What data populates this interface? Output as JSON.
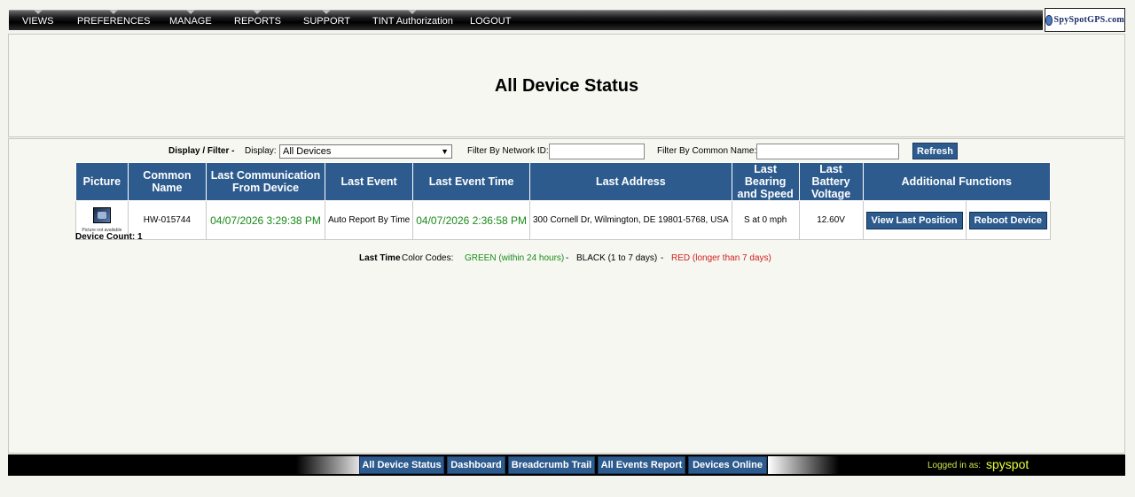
{
  "nav": {
    "items": [
      "VIEWS",
      "PREFERENCES",
      "MANAGE",
      "REPORTS",
      "SUPPORT",
      "TINT Authorization",
      "LOGOUT"
    ],
    "logo_text": "SpySpotGPS.com"
  },
  "page": {
    "title": "All Device Status"
  },
  "filter": {
    "heading": "Display / Filter -",
    "display_label": "Display:",
    "display_value": "All Devices",
    "network_label": "Filter By Network ID:",
    "network_value": "",
    "common_name_label": "Filter By Common Name:",
    "common_name_value": "",
    "refresh_label": "Refresh"
  },
  "table": {
    "headers": {
      "picture": "Picture",
      "common_name": "Common Name",
      "last_comm": "Last Communication From Device",
      "last_event": "Last Event",
      "last_event_time": "Last Event Time",
      "last_address": "Last Address",
      "bearing": "Last Bearing and Speed",
      "battery": "Last Battery Voltage",
      "functions": "Additional Functions"
    },
    "rows": [
      {
        "picture_caption": "Picture not available",
        "common_name": "HW-015744",
        "last_comm": "04/07/2026 3:29:38 PM",
        "last_event": "Auto Report By Time",
        "last_event_time": "04/07/2026 2:36:58 PM",
        "last_address": "300 Cornell Dr, Wilmington, DE 19801-5768, USA",
        "bearing": "S at 0 mph",
        "battery": "12.60V",
        "view_btn": "View Last Position",
        "reboot_btn": "Reboot Device"
      }
    ]
  },
  "device_count": "Device Count: 1",
  "legend": {
    "label_bold": "Last Time",
    "label_rest": "Color Codes:",
    "green": "GREEN (within 24 hours)",
    "sep1": "-",
    "black": "BLACK (1 to 7 days)",
    "sep2": "-",
    "red": "RED (longer than 7 days)"
  },
  "colors": {
    "accent": "#2d5b8e",
    "green": "#1a8a1a",
    "red": "#d02020"
  },
  "bottom": {
    "buttons": [
      "All Device Status",
      "Dashboard",
      "Breadcrumb Trail",
      "All Events Report",
      "Devices Online"
    ],
    "logged_label": "Logged in as:",
    "username": "spyspot"
  }
}
